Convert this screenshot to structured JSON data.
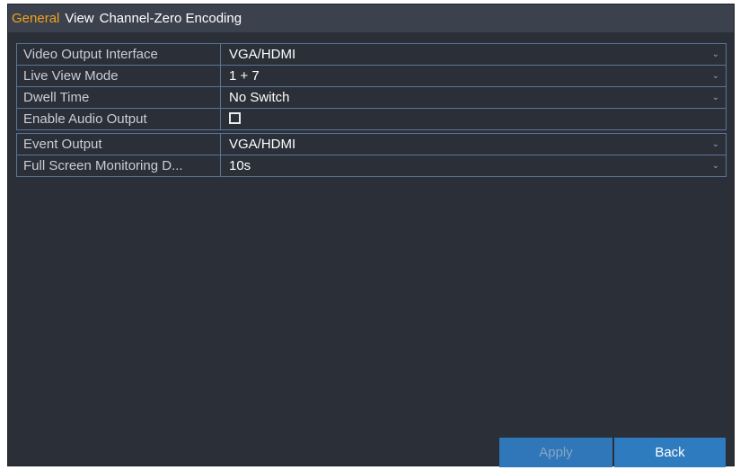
{
  "tabs": [
    {
      "label": "General",
      "active": true
    },
    {
      "label": "View",
      "active": false
    },
    {
      "label": "Channel-Zero Encoding",
      "active": false
    }
  ],
  "settings": {
    "video_output_interface": {
      "label": "Video Output Interface",
      "value": "VGA/HDMI"
    },
    "live_view_mode": {
      "label": "Live View Mode",
      "value": "1 + 7"
    },
    "dwell_time": {
      "label": "Dwell Time",
      "value": "No Switch"
    },
    "enable_audio_output": {
      "label": "Enable Audio Output",
      "checked": false
    },
    "event_output": {
      "label": "Event Output",
      "value": "VGA/HDMI"
    },
    "full_screen_monitoring": {
      "label": "Full Screen Monitoring D...",
      "value": "10s"
    }
  },
  "buttons": {
    "apply": {
      "label": "Apply",
      "enabled": false
    },
    "back": {
      "label": "Back",
      "enabled": true
    }
  },
  "colors": {
    "active_tab": "#f4a21b",
    "panel_bg": "#2a2f38",
    "tabbar_bg": "#3b414d",
    "row_border": "#5b7597",
    "button_bg": "#2f7bc0"
  }
}
